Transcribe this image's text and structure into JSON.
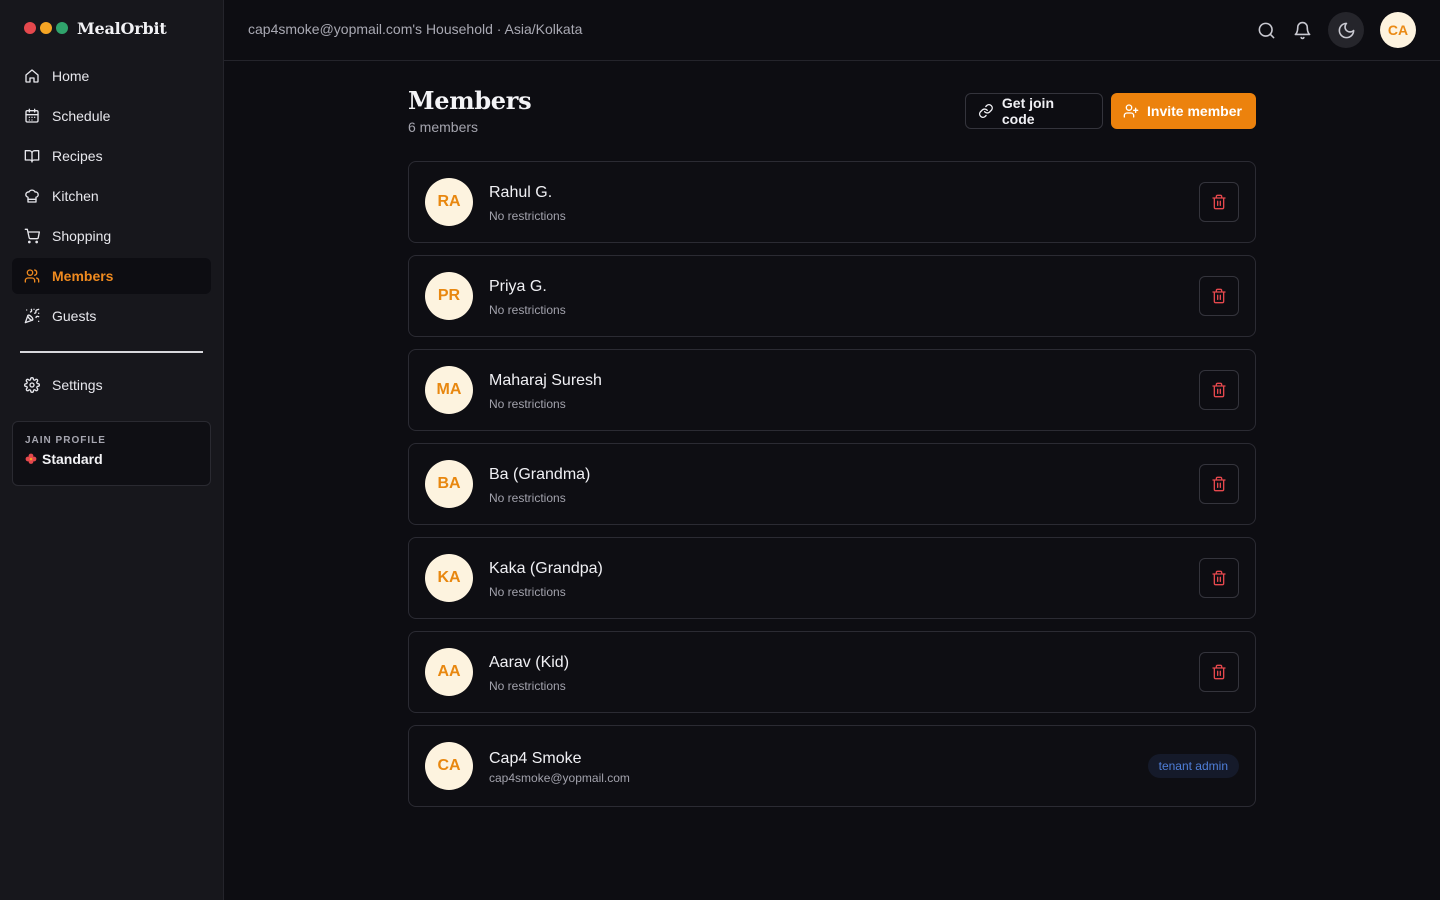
{
  "brand": {
    "name": "MealOrbit",
    "dot_colors": [
      "#e5484d",
      "#f5a524",
      "#30a46c"
    ]
  },
  "nav": {
    "items": [
      {
        "label": "Home",
        "icon": "home-icon",
        "active": false
      },
      {
        "label": "Schedule",
        "icon": "calendar-icon",
        "active": false
      },
      {
        "label": "Recipes",
        "icon": "book-icon",
        "active": false
      },
      {
        "label": "Kitchen",
        "icon": "chef-hat-icon",
        "active": false
      },
      {
        "label": "Shopping",
        "icon": "cart-icon",
        "active": false
      },
      {
        "label": "Members",
        "icon": "users-icon",
        "active": true
      },
      {
        "label": "Guests",
        "icon": "party-icon",
        "active": false
      }
    ],
    "settings": {
      "label": "Settings",
      "icon": "gear-icon"
    }
  },
  "profile": {
    "label": "JAIN PROFILE",
    "value": "Standard"
  },
  "header": {
    "household": "cap4smoke@yopmail.com's Household · Asia/Kolkata",
    "avatar": "CA"
  },
  "page": {
    "title": "Members",
    "subtitle": "6 members",
    "join_code_label": "Get join code",
    "invite_label": "Invite member"
  },
  "members": [
    {
      "initials": "RA",
      "name": "Rahul G.",
      "detail": "No restrictions",
      "action": "delete"
    },
    {
      "initials": "PR",
      "name": "Priya G.",
      "detail": "No restrictions",
      "action": "delete"
    },
    {
      "initials": "MA",
      "name": "Maharaj Suresh",
      "detail": "No restrictions",
      "action": "delete"
    },
    {
      "initials": "BA",
      "name": "Ba (Grandma)",
      "detail": "No restrictions",
      "action": "delete"
    },
    {
      "initials": "KA",
      "name": "Kaka (Grandpa)",
      "detail": "No restrictions",
      "action": "delete"
    },
    {
      "initials": "AA",
      "name": "Aarav (Kid)",
      "detail": "No restrictions",
      "action": "delete"
    },
    {
      "initials": "CA",
      "name": "Cap4 Smoke",
      "detail": "cap4smoke@yopmail.com",
      "action": "badge",
      "badge": "tenant admin"
    }
  ],
  "colors": {
    "accent": "#ec820d",
    "danger": "#e5484d",
    "badge": "#4f7fd9"
  }
}
